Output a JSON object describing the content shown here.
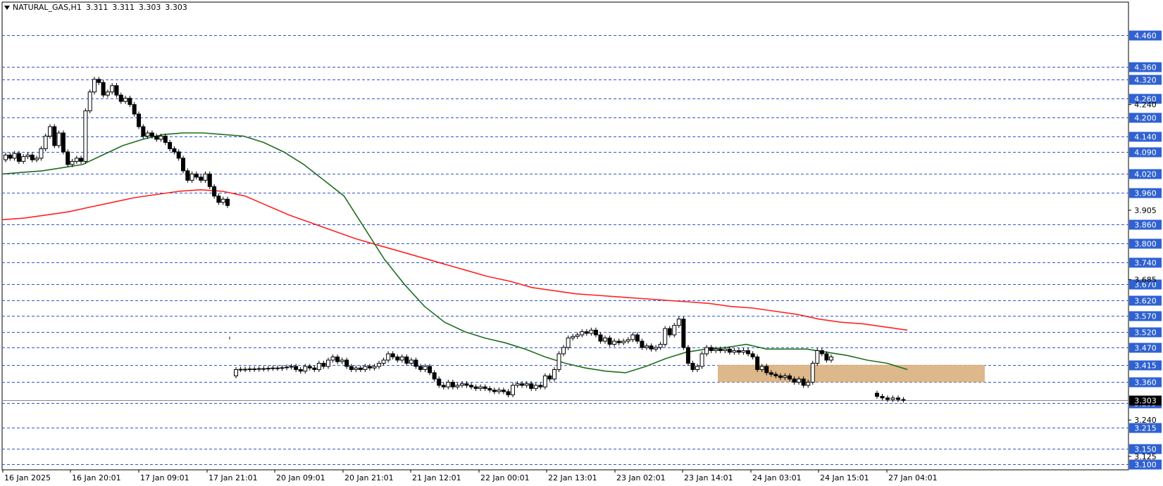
{
  "header": {
    "symbol": "NATURAL_GAS,H1",
    "values": [
      "3.311",
      "3.311",
      "3.303",
      "3.303"
    ]
  },
  "colors": {
    "background": "#ffffff",
    "grid": "#3355cc",
    "level_label_bg": "#2f61d1",
    "ma_fast": "#1e6e1e",
    "ma_slow": "#ff2222",
    "zone": "#d9b07d",
    "candle": "#000000"
  },
  "chart_data": {
    "type": "candlestick",
    "symbol": "NATURAL_GAS",
    "timeframe": "H1",
    "ylim": [
      3.1,
      4.52
    ],
    "horizontal_levels": [
      4.46,
      4.36,
      4.32,
      4.26,
      4.2,
      4.14,
      4.09,
      4.02,
      3.96,
      3.86,
      3.8,
      3.74,
      3.67,
      3.62,
      3.57,
      3.52,
      3.47,
      3.415,
      3.36,
      3.295,
      3.215,
      3.15,
      3.1
    ],
    "axis_ticks": [
      "4.240",
      "3.905",
      "3.685",
      "3.240",
      "3.125"
    ],
    "current_price_label": "3.303",
    "x_labels": [
      "16 Jan 2025",
      "16 Jan 20:01",
      "17 Jan 09:01",
      "17 Jan 21:01",
      "20 Jan 09:01",
      "20 Jan 21:01",
      "21 Jan 12:01",
      "22 Jan 00:01",
      "22 Jan 13:01",
      "23 Jan 02:01",
      "23 Jan 14:01",
      "24 Jan 03:01",
      "24 Jan 15:01",
      "27 Jan 04:01"
    ],
    "zone": {
      "from": 3.36,
      "to": 3.415
    },
    "candles": [
      [
        4.065,
        4.08
      ],
      [
        4.08,
        4.07
      ],
      [
        4.07,
        4.085
      ],
      [
        4.085,
        4.06
      ],
      [
        4.06,
        4.075
      ],
      [
        4.075,
        4.08
      ],
      [
        4.08,
        4.065
      ],
      [
        4.065,
        4.07
      ],
      [
        4.07,
        4.1
      ],
      [
        4.1,
        4.14
      ],
      [
        4.14,
        4.17
      ],
      [
        4.17,
        4.11
      ],
      [
        4.11,
        4.15
      ],
      [
        4.15,
        4.09
      ],
      [
        4.09,
        4.05
      ],
      [
        4.05,
        4.06
      ],
      [
        4.06,
        4.07
      ],
      [
        4.07,
        4.06
      ],
      [
        4.06,
        4.22
      ],
      [
        4.22,
        4.28
      ],
      [
        4.28,
        4.32
      ],
      [
        4.32,
        4.31
      ],
      [
        4.31,
        4.27
      ],
      [
        4.27,
        4.28
      ],
      [
        4.28,
        4.3
      ],
      [
        4.3,
        4.27
      ],
      [
        4.27,
        4.25
      ],
      [
        4.25,
        4.26
      ],
      [
        4.26,
        4.24
      ],
      [
        4.24,
        4.21
      ],
      [
        4.21,
        4.17
      ],
      [
        4.17,
        4.14
      ],
      [
        4.14,
        4.15
      ],
      [
        4.15,
        4.14
      ],
      [
        4.14,
        4.13
      ],
      [
        4.13,
        4.14
      ],
      [
        4.14,
        4.12
      ],
      [
        4.12,
        4.1
      ],
      [
        4.1,
        4.09
      ],
      [
        4.09,
        4.07
      ],
      [
        4.07,
        4.03
      ],
      [
        4.03,
        4.0
      ],
      [
        4.0,
        4.02
      ],
      [
        4.02,
        4.01
      ],
      [
        4.01,
        4.0
      ],
      [
        4.0,
        4.02
      ],
      [
        4.02,
        3.98
      ],
      [
        3.98,
        3.95
      ],
      [
        3.95,
        3.93
      ],
      [
        3.93,
        3.94
      ],
      [
        3.94,
        3.92
      ],
      [
        3.38,
        3.4
      ],
      [
        3.4,
        3.401
      ],
      [
        3.401,
        3.4
      ],
      [
        3.4,
        3.402
      ],
      [
        3.402,
        3.401
      ],
      [
        3.401,
        3.403
      ],
      [
        3.403,
        3.402
      ],
      [
        3.402,
        3.404
      ],
      [
        3.404,
        3.405
      ],
      [
        3.405,
        3.404
      ],
      [
        3.404,
        3.406
      ],
      [
        3.406,
        3.408
      ],
      [
        3.408,
        3.41
      ],
      [
        3.41,
        3.4
      ],
      [
        3.4,
        3.395
      ],
      [
        3.395,
        3.41
      ],
      [
        3.41,
        3.405
      ],
      [
        3.405,
        3.4
      ],
      [
        3.4,
        3.42
      ],
      [
        3.42,
        3.41
      ],
      [
        3.41,
        3.43
      ],
      [
        3.43,
        3.44
      ],
      [
        3.44,
        3.425
      ],
      [
        3.425,
        3.43
      ],
      [
        3.43,
        3.41
      ],
      [
        3.41,
        3.4
      ],
      [
        3.4,
        3.405
      ],
      [
        3.405,
        3.4
      ],
      [
        3.4,
        3.41
      ],
      [
        3.41,
        3.405
      ],
      [
        3.405,
        3.41
      ],
      [
        3.41,
        3.42
      ],
      [
        3.42,
        3.43
      ],
      [
        3.43,
        3.45
      ],
      [
        3.45,
        3.44
      ],
      [
        3.44,
        3.43
      ],
      [
        3.43,
        3.44
      ],
      [
        3.44,
        3.42
      ],
      [
        3.42,
        3.43
      ],
      [
        3.43,
        3.41
      ],
      [
        3.41,
        3.4
      ],
      [
        3.4,
        3.41
      ],
      [
        3.41,
        3.39
      ],
      [
        3.39,
        3.37
      ],
      [
        3.37,
        3.35
      ],
      [
        3.35,
        3.345
      ],
      [
        3.345,
        3.36
      ],
      [
        3.36,
        3.345
      ],
      [
        3.345,
        3.35
      ],
      [
        3.35,
        3.355
      ],
      [
        3.355,
        3.35
      ],
      [
        3.35,
        3.345
      ],
      [
        3.345,
        3.34
      ],
      [
        3.34,
        3.345
      ],
      [
        3.345,
        3.34
      ],
      [
        3.34,
        3.335
      ],
      [
        3.335,
        3.33
      ],
      [
        3.33,
        3.335
      ],
      [
        3.335,
        3.33
      ],
      [
        3.33,
        3.32
      ],
      [
        3.32,
        3.35
      ],
      [
        3.35,
        3.355
      ],
      [
        3.355,
        3.35
      ],
      [
        3.35,
        3.355
      ],
      [
        3.355,
        3.34
      ],
      [
        3.34,
        3.35
      ],
      [
        3.35,
        3.345
      ],
      [
        3.345,
        3.38
      ],
      [
        3.38,
        3.37
      ],
      [
        3.37,
        3.4
      ],
      [
        3.4,
        3.45
      ],
      [
        3.45,
        3.47
      ],
      [
        3.47,
        3.5
      ],
      [
        3.5,
        3.505
      ],
      [
        3.505,
        3.51
      ],
      [
        3.51,
        3.52
      ],
      [
        3.52,
        3.515
      ],
      [
        3.515,
        3.525
      ],
      [
        3.525,
        3.51
      ],
      [
        3.51,
        3.49
      ],
      [
        3.49,
        3.5
      ],
      [
        3.5,
        3.48
      ],
      [
        3.48,
        3.49
      ],
      [
        3.49,
        3.485
      ],
      [
        3.485,
        3.49
      ],
      [
        3.49,
        3.495
      ],
      [
        3.495,
        3.51
      ],
      [
        3.51,
        3.49
      ],
      [
        3.49,
        3.47
      ],
      [
        3.47,
        3.475
      ],
      [
        3.475,
        3.465
      ],
      [
        3.465,
        3.47
      ],
      [
        3.47,
        3.48
      ],
      [
        3.48,
        3.53
      ],
      [
        3.53,
        3.51
      ],
      [
        3.51,
        3.54
      ],
      [
        3.54,
        3.56
      ],
      [
        3.56,
        3.47
      ],
      [
        3.47,
        3.42
      ],
      [
        3.42,
        3.4
      ],
      [
        3.4,
        3.41
      ],
      [
        3.41,
        3.45
      ],
      [
        3.45,
        3.47
      ],
      [
        3.47,
        3.46
      ],
      [
        3.46,
        3.465
      ],
      [
        3.465,
        3.46
      ],
      [
        3.46,
        3.465
      ],
      [
        3.465,
        3.455
      ],
      [
        3.455,
        3.46
      ],
      [
        3.46,
        3.455
      ],
      [
        3.455,
        3.46
      ],
      [
        3.46,
        3.45
      ],
      [
        3.45,
        3.44
      ],
      [
        3.44,
        3.4
      ],
      [
        3.4,
        3.41
      ],
      [
        3.41,
        3.39
      ],
      [
        3.39,
        3.385
      ],
      [
        3.385,
        3.38
      ],
      [
        3.38,
        3.375
      ],
      [
        3.375,
        3.38
      ],
      [
        3.38,
        3.37
      ],
      [
        3.37,
        3.36
      ],
      [
        3.36,
        3.37
      ],
      [
        3.37,
        3.35
      ],
      [
        3.35,
        3.36
      ],
      [
        3.36,
        3.42
      ],
      [
        3.42,
        3.46
      ],
      [
        3.46,
        3.45
      ],
      [
        3.45,
        3.43
      ],
      [
        3.43,
        3.44
      ],
      [
        3.325,
        3.315
      ],
      [
        3.315,
        3.31
      ],
      [
        3.31,
        3.305
      ],
      [
        3.305,
        3.31
      ],
      [
        3.31,
        3.305
      ],
      [
        3.305,
        3.303
      ]
    ],
    "ma_fast": [
      4.02,
      4.025,
      4.03,
      4.04,
      4.05,
      4.08,
      4.11,
      4.13,
      4.145,
      4.15,
      4.15,
      4.145,
      4.14,
      4.12,
      4.09,
      4.05,
      4.0,
      3.95,
      3.85,
      3.75,
      3.67,
      3.6,
      3.55,
      3.52,
      3.5,
      3.485,
      3.465,
      3.44,
      3.42,
      3.405,
      3.395,
      3.39,
      3.41,
      3.435,
      3.455,
      3.465,
      3.47,
      3.48,
      3.465,
      3.465,
      3.465,
      3.455,
      3.445,
      3.43,
      3.42,
      3.4
    ],
    "ma_slow": [
      3.875,
      3.88,
      3.89,
      3.9,
      3.915,
      3.93,
      3.945,
      3.955,
      3.965,
      3.97,
      3.965,
      3.95,
      3.92,
      3.89,
      3.865,
      3.84,
      3.815,
      3.795,
      3.775,
      3.755,
      3.735,
      3.715,
      3.695,
      3.68,
      3.66,
      3.65,
      3.64,
      3.635,
      3.63,
      3.625,
      3.62,
      3.615,
      3.61,
      3.6,
      3.595,
      3.585,
      3.575,
      3.56,
      3.55,
      3.545,
      3.535,
      3.525
    ]
  }
}
